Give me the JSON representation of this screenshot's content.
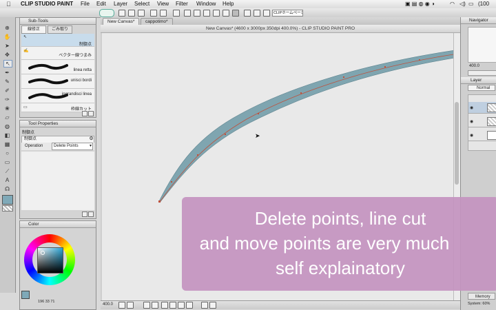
{
  "menubar": {
    "app_name": "CLIP STUDIO PAINT",
    "items": [
      "File",
      "Edit",
      "Layer",
      "Select",
      "View",
      "Filter",
      "Window",
      "Help"
    ],
    "battery": "(100"
  },
  "command_bar": {
    "home_label": "CLIPホームページ"
  },
  "subtool_panel": {
    "title": "Sub-Tools",
    "tab_1": "線修正",
    "tab_2": "ごみ取り",
    "items": [
      {
        "label": "制御点"
      },
      {
        "label": "ベクター線つまみ"
      },
      {
        "label": "linea retta"
      },
      {
        "label": "unisci bordi"
      },
      {
        "label": "ingrandisci linea"
      },
      {
        "label": "枠線カット"
      }
    ]
  },
  "tool_property": {
    "title": "Tool Properties",
    "subtitle": "制御点",
    "header": "制御点",
    "operation_label": "Operation",
    "operation_value": "Delete Points"
  },
  "color_panel": {
    "title": "Color",
    "status_text": "196 33 71",
    "main_color": "#7fa9b8",
    "sub_color": "#ffffff"
  },
  "canvas_window": {
    "tabs": [
      "New Canvas*",
      "cappotimo*"
    ],
    "title": "New Canvas* (4600 x 3000px 350dpi 400.0%) - CLIP STUDIO PAINT PRO",
    "zoom": "400.0",
    "stroke_color": "#7fa5b0"
  },
  "right_panel": {
    "navigator_title": "Navigator",
    "zoom": "400.0",
    "layer_title": "Layer",
    "blend_mode": "Normal",
    "memory_label": "Memory",
    "system_label": "System: 60%"
  },
  "caption": {
    "line1": "Delete points, line cut",
    "line2": "and move points are very much",
    "line3": "self explainatory"
  }
}
